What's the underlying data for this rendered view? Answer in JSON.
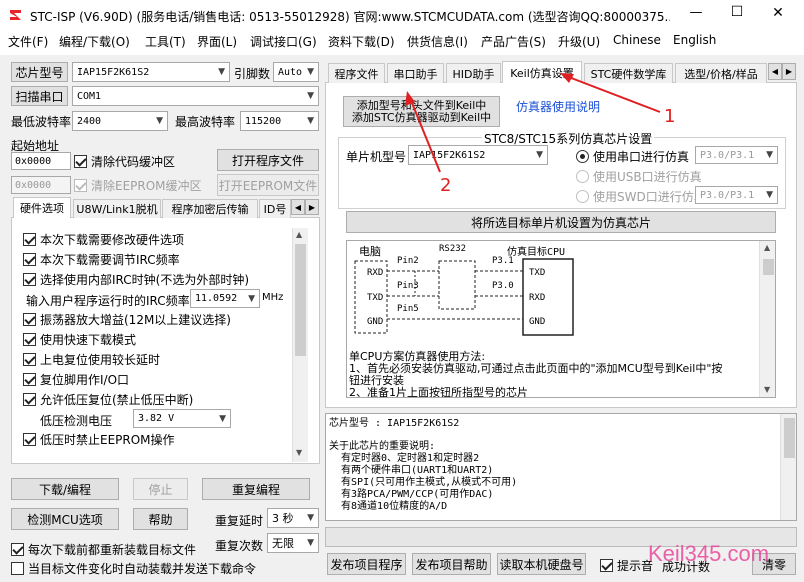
{
  "window": {
    "title": "STC-ISP (V6.90D) (服务电话/销售电话: 0513-55012928) 官网:www.STCMCUDATA.com  (选型咨询QQ:80000375...",
    "min": "—",
    "max": "☐",
    "close": "✕"
  },
  "menu": [
    "文件(F)",
    "编程/下载(O)",
    "工具(T)",
    "界面(L)",
    "调试接口(G)",
    "资料下载(D)",
    "供货信息(I)",
    "产品广告(S)",
    "升级(U)",
    "Chinese",
    "English"
  ],
  "left": {
    "chip_type_label": "芯片型号",
    "chip_type_value": "IAP15F2K61S2",
    "pin_count_label": "引脚数",
    "pin_count_value": "Auto",
    "scan_port_label": "扫描串口",
    "port_value": "COM1",
    "min_baud_label": "最低波特率",
    "min_baud_value": "2400",
    "max_baud_label": "最高波特率",
    "max_baud_value": "115200",
    "start_addr_label": "起始地址",
    "code_addr": "0x0000",
    "clear_code_label": "清除代码缓冲区",
    "open_prog_file": "打开程序文件",
    "eeprom_addr": "0x0000",
    "clear_eeprom_label": "清除EEPROM缓冲区",
    "open_eeprom_file": "打开EEPROM文件",
    "tabs": [
      "硬件选项",
      "U8W/Link1脱机",
      "程序加密后传输",
      "ID号"
    ],
    "options": [
      {
        "label": "本次下载需要修改硬件选项",
        "checked": true
      },
      {
        "label": "本次下载需要调节IRC频率",
        "checked": true
      },
      {
        "label": "选择使用内部IRC时钟(不选为外部时钟)",
        "checked": true
      }
    ],
    "irc_label": "输入用户程序运行时的IRC频率",
    "irc_value": "11.0592",
    "irc_unit": "MHz",
    "options2": [
      {
        "label": "振荡器放大增益(12M以上建议选择)",
        "checked": true
      },
      {
        "label": "使用快速下载模式",
        "checked": true
      },
      {
        "label": "上电复位使用较长延时",
        "checked": true
      },
      {
        "label": "复位脚用作I/O口",
        "checked": true
      },
      {
        "label": "允许低压复位(禁止低压中断)",
        "checked": true
      }
    ],
    "lvd_label": "低压检测电压",
    "lvd_value": "3.82 V",
    "option_last": {
      "label": "低压时禁止EEPROM操作",
      "checked": true
    },
    "download_btn": "下载/编程",
    "stop_btn": "停止",
    "reprog_btn": "重复编程",
    "detect_btn": "检测MCU选项",
    "help_btn": "帮助",
    "repeat_delay_label": "重复延时",
    "repeat_delay_value": "3 秒",
    "repeat_count_label": "重复次数",
    "repeat_count_value": "无限",
    "reload_label": "每次下载前都重新装载目标文件",
    "auto_send_label": "当目标文件变化时自动装载并发送下载命令"
  },
  "right": {
    "tabs": [
      "程序文件",
      "串口助手",
      "HID助手",
      "Keil仿真设置",
      "STC硬件数学库",
      "选型/价格/样品"
    ],
    "add_keil_btn_line1": "添加型号和头文件到Keil中",
    "add_keil_btn_line2": "添加STC仿真器驱动到Keil中",
    "emu_manual_link": "仿真器使用说明",
    "group_title": "STC8/STC15系列仿真芯片设置",
    "mcu_type_label": "单片机型号",
    "mcu_type_value": "IAP15F2K61S2",
    "radio_serial": "使用串口进行仿真",
    "radio_serial_val": "P3.0/P3.1",
    "radio_usb": "使用USB口进行仿真",
    "radio_swd": "使用SWD口进行仿真",
    "radio_swd_val": "P3.0/P3.1",
    "set_emu_btn": "将所选目标单片机设置为仿真芯片",
    "diagram": {
      "pc": "电脑",
      "rs232": "RS232",
      "target": "仿真目标CPU",
      "rxd": "RXD",
      "txd": "TXD",
      "gnd": "GND",
      "pin2": "Pin2",
      "pin3": "Pin3",
      "pin5": "Pin5",
      "p31": "P3.1",
      "p30": "P3.0",
      "t_txd": "TXD",
      "t_rxd": "RXD",
      "t_gnd": "GND"
    },
    "method_text1": "单CPU方案仿真器使用方法:",
    "method_text2": "1、首先必须安装仿真驱动,可通过点击此页面中的\"添加MCU型号到Keil中\"按",
    "method_text3": "钮进行安装",
    "method_text4": "2、准备1片上面按钮所指型号的芯片",
    "info_line1": "芯片型号 : IAP15F2K61S2",
    "info_line2": "关于此芯片的重要说明:",
    "info_line3": "  有定时器0、定时器1和定时器2",
    "info_line4": "  有两个硬件串口(UART1和UART2)",
    "info_line5": "  有SPI(只可用作主模式,从模式不可用)",
    "info_line6": "  有3路PCA/PWM/CCP(可用作DAC)",
    "info_line7": "  有8通道10位精度的A/D",
    "publish_prog": "发布项目程序",
    "publish_help": "发布项目帮助",
    "read_disk": "读取本机硬盘号",
    "hint_label": "提示音",
    "success_count": "成功计数",
    "clear_btn": "清零"
  },
  "annotations": {
    "num1": "1",
    "num2": "2"
  },
  "watermark": "Keil345.com"
}
